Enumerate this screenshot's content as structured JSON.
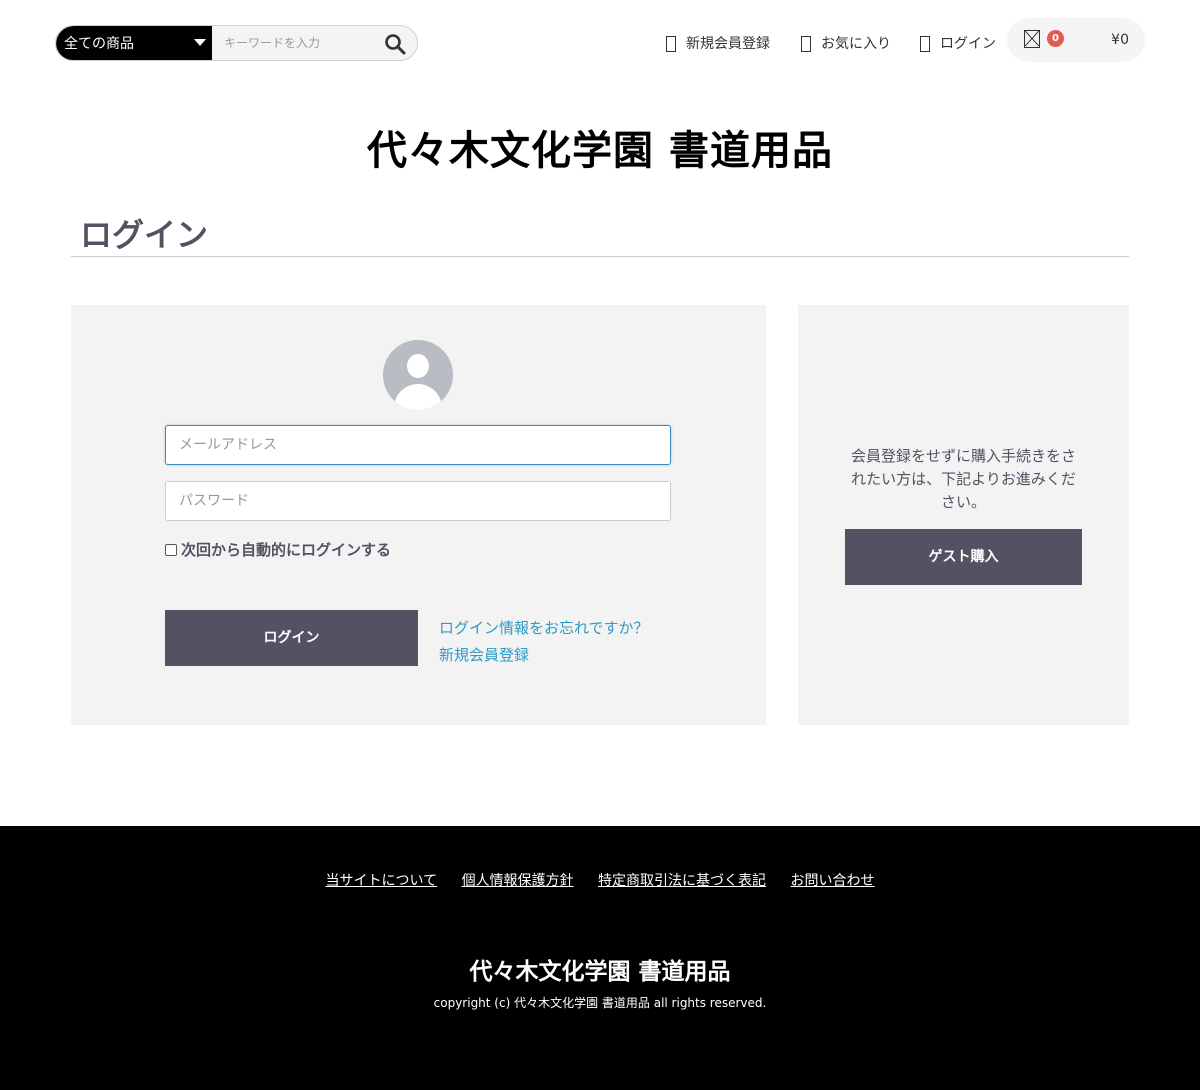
{
  "header": {
    "category_label": "全ての商品",
    "search_placeholder": "キーワードを入力",
    "nav": {
      "signup": "新規会員登録",
      "favorites": "お気に入り",
      "login": "ログイン"
    },
    "cart": {
      "count": "0",
      "total": "¥0"
    }
  },
  "site_title": "代々木文化学園 書道用品",
  "page_heading": "ログイン",
  "login_form": {
    "email_placeholder": "メールアドレス",
    "password_placeholder": "パスワード",
    "remember_label": "次回から自動的にログインする",
    "login_button": "ログイン",
    "forgot_link": "ログイン情報をお忘れですか？",
    "signup_link": "新規会員登録"
  },
  "guest": {
    "text": "会員登録をせずに購入手続きをされたい方は、下記よりお進みください。",
    "button": "ゲスト購入"
  },
  "footer": {
    "links": [
      "当サイトについて",
      "個人情報保護方針",
      "特定商取引法に基づく表記",
      "お問い合わせ"
    ],
    "title": "代々木文化学園 書道用品",
    "copyright": "copyright (c) 代々木文化学園 書道用品 all rights reserved."
  },
  "colors": {
    "button_bg": "#525263",
    "link": "#2e9ac4",
    "badge": "#de5d50",
    "panel_bg": "#f3f3f3",
    "footer_bg": "#000000"
  }
}
